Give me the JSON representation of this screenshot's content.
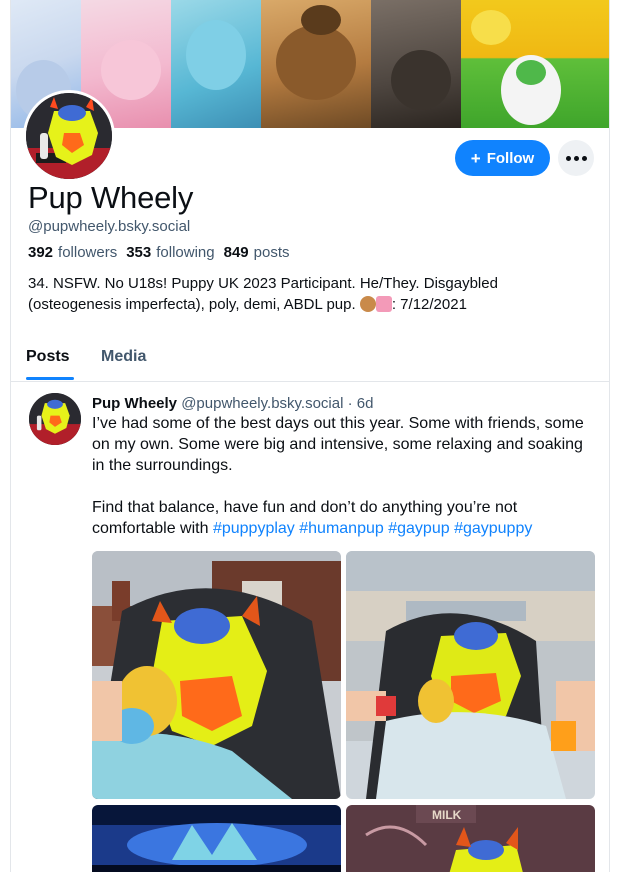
{
  "profile": {
    "display_name": "Pup Wheely",
    "handle": "@pupwheely.bsky.social",
    "followers_count": "392",
    "followers_label": "followers",
    "following_count": "353",
    "following_label": "following",
    "posts_count": "849",
    "posts_label": "posts",
    "bio_line1": "34. NSFW. No U18s! Puppy UK 2023 Participant. He/They. Disgaybled",
    "bio_line2_pre": "(osteogenesis imperfecta), poly, demi, ABDL pup.",
    "bio_line2_post": ": 7/12/2021"
  },
  "actions": {
    "follow_label": "Follow",
    "more_icon": "more-dots-icon"
  },
  "tabs": [
    {
      "label": "Posts",
      "active": true
    },
    {
      "label": "Media",
      "active": false
    }
  ],
  "post": {
    "author": "Pup Wheely",
    "handle": "@pupwheely.bsky.social",
    "separator": "·",
    "age": "6d",
    "text_p1": "I’ve had some of the best days out this year. Some with friends, some on my own. Some were big and intensive, some relaxing and soaking in the surroundings.",
    "text_p2": "Find that balance, have fun and don’t do anything you’re not comfortable with",
    "hashtags": [
      "#puppyplay",
      "#humanpup",
      "#gaypup",
      "#gaypuppy"
    ]
  },
  "colors": {
    "accent": "#1083fe",
    "muted_text": "#42576c",
    "text": "#0b0f14",
    "divider": "#e3e6ea"
  }
}
